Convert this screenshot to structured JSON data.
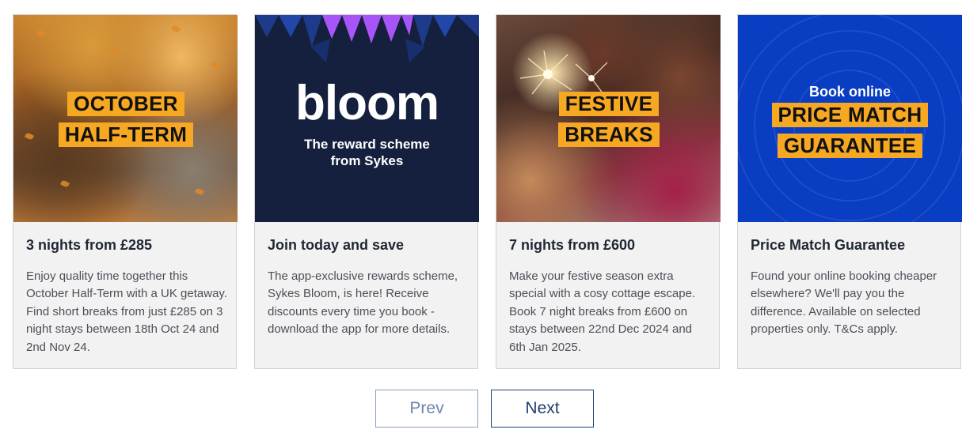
{
  "cards": [
    {
      "tag_lines": [
        "OCTOBER",
        "HALF-TERM"
      ],
      "title": "3 nights from £285",
      "description": "Enjoy quality time together this October Half-Term with a UK getaway. Find short breaks from just £285 on 3 night stays between 18th Oct 24 and 2nd Nov 24."
    },
    {
      "logo": "bloom",
      "image_subtitle": "The reward scheme from Sykes",
      "title": "Join today and save",
      "description": "The app-exclusive rewards scheme, Sykes Bloom, is here! Receive discounts every time you book - download the app for more details."
    },
    {
      "tag_lines": [
        "FESTIVE",
        "BREAKS"
      ],
      "title": "7 nights from £600",
      "description": "Make your festive season extra special with a cosy cottage escape. Book 7 night breaks from £600 on stays between 22nd Dec 2024 and 6th Jan 2025."
    },
    {
      "image_heading": "Book online",
      "tag_lines": [
        "PRICE MATCH",
        "GUARANTEE"
      ],
      "title": "Price Match Guarantee",
      "description": "Found your online booking cheaper elsewhere? We'll pay you the difference. Available on selected properties only. T&Cs apply."
    }
  ],
  "navigation": {
    "prev_label": "Prev",
    "next_label": "Next"
  },
  "colors": {
    "tag_background": "#f7a823",
    "bloom_background": "#14203d",
    "price_background": "#0a3ec2",
    "card_background": "#f2f2f2",
    "next_border": "#1f3f70"
  }
}
